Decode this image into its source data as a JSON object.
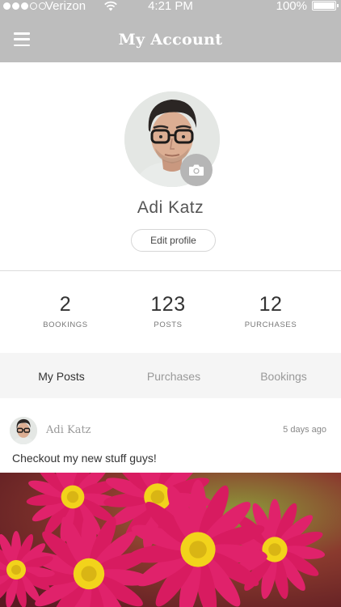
{
  "status_bar": {
    "carrier": "Verizon",
    "time": "4:21 PM",
    "battery": "100%",
    "signal_bars_filled": 3,
    "signal_bars_total": 5
  },
  "nav": {
    "title": "My Account",
    "menu_icon": "hamburger-menu-icon"
  },
  "profile": {
    "name": "Adi Katz",
    "edit_label": "Edit profile",
    "camera_icon": "camera-icon"
  },
  "stats": [
    {
      "value": "2",
      "label": "BOOKINGS"
    },
    {
      "value": "123",
      "label": "POSTS"
    },
    {
      "value": "12",
      "label": "PURCHASES"
    }
  ],
  "tabs": [
    {
      "label": "My Posts",
      "active": true
    },
    {
      "label": "Purchases",
      "active": false
    },
    {
      "label": "Bookings",
      "active": false
    }
  ],
  "post": {
    "author": "Adi Katz",
    "time": "5 days ago",
    "text": "Checkout my new stuff guys!"
  },
  "colors": {
    "header_bg": "#bdbdbd",
    "tabs_bg": "#f5f5f5",
    "camera_btn": "#b6b6b6",
    "flower_pink": "#d81b60",
    "flower_center": "#f2d31b"
  }
}
